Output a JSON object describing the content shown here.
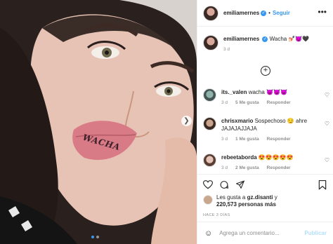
{
  "header": {
    "username": "emiliamernes",
    "separator": "•",
    "follow_label": "Seguir",
    "more_label": "•••"
  },
  "caption": {
    "username": "emiliamernes",
    "text": "Wacha 💅🏻😈🖤",
    "time": "3 d"
  },
  "load_more_label": "+",
  "comments": [
    {
      "username": "its._valen",
      "text": "wacha 😈😈😈",
      "time": "3 d",
      "likes": "5 Me gusta",
      "reply": "Responder"
    },
    {
      "username": "chrisxmario",
      "text": "Sospechoso 😏 ahre JAJAJAJJAJA",
      "time": "3 d",
      "likes": "1 Me gusta",
      "reply": "Responder"
    },
    {
      "username": "rebeetaborda",
      "text": "😍😍😍😍😍",
      "time": "3 d",
      "likes": "2 Me gusta",
      "reply": "Responder"
    }
  ],
  "likes": {
    "prefix": "Les gusta a ",
    "user": "gz.disanti",
    "middle": " y",
    "count": "220,573 personas más"
  },
  "posted_ago": "HACE 3 DÍAS",
  "comment_box": {
    "placeholder": "Agrega un comentario...",
    "publish_label": "Publicar",
    "emoji_icon": "☺"
  },
  "photo": {
    "lip_text": "WACHA"
  },
  "colors": {
    "accent": "#3897f0",
    "publish_disabled": "#b2dffc",
    "muted": "#8e8e8e"
  }
}
